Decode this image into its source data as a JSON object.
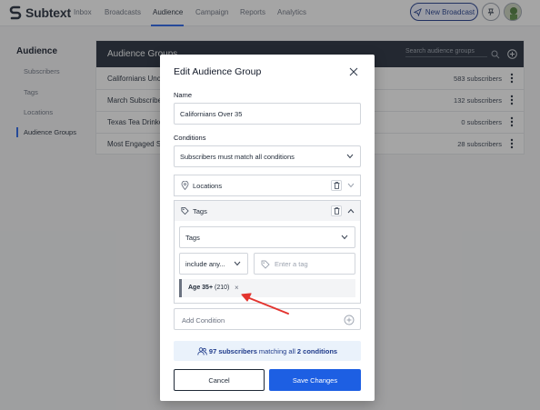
{
  "app": {
    "brand": "Subtext",
    "nav": [
      "Inbox",
      "Broadcasts",
      "Audience",
      "Campaign",
      "Reports",
      "Analytics"
    ],
    "active_nav": "Audience",
    "new_broadcast_label": "New Broadcast"
  },
  "sidebar": {
    "title": "Audience",
    "items": [
      {
        "label": "Subscribers"
      },
      {
        "label": "Tags"
      },
      {
        "label": "Locations"
      },
      {
        "label": "Audience Groups"
      }
    ],
    "active_item": "Audience Groups"
  },
  "background_panel": {
    "title": "Audience Groups",
    "search_placeholder": "Search audience groups",
    "rows": [
      {
        "name": "Californians Unc",
        "count": "583 subscribers"
      },
      {
        "name": "March Subscribe",
        "count": "132 subscribers"
      },
      {
        "name": "Texas Tea Drinke",
        "count": "0 subscribers"
      },
      {
        "name": "Most Engaged S",
        "count": "28 subscribers"
      }
    ]
  },
  "modal": {
    "title": "Edit Audience Group",
    "name_label": "Name",
    "name_value": "Californians Over 35",
    "conditions_label": "Conditions",
    "conditions_value": "Subscribers must match all conditions",
    "locations_section": "Locations",
    "tags_section": "Tags",
    "tags_select": "Tags",
    "include_select": "include any...",
    "tag_input_placeholder": "Enter a tag",
    "chip_label": "Age 35+",
    "chip_count": "(210)",
    "chip_remove": "×",
    "add_condition": "Add Condition",
    "match": {
      "count": "97 subscribers",
      "middle": "matching all",
      "conditions": "2 conditions"
    },
    "cancel_label": "Cancel",
    "save_label": "Save Changes"
  },
  "colors": {
    "accent": "#2563eb",
    "primary_button": "#1d5fe3",
    "table_header": "#1f2937",
    "arrow": "#e3342f"
  }
}
